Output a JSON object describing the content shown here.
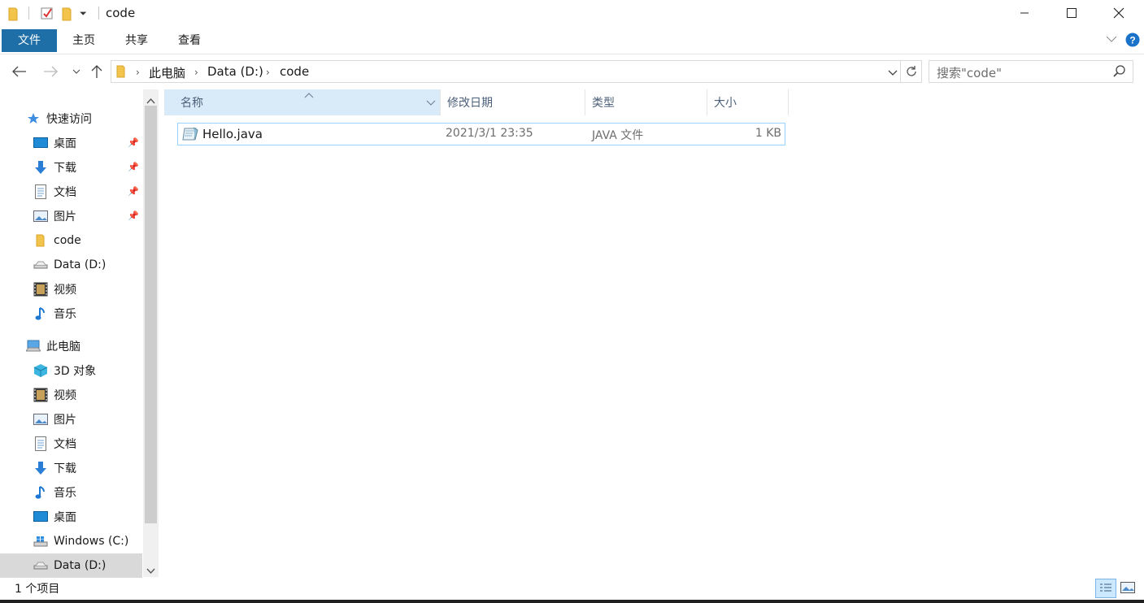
{
  "window": {
    "title": "code",
    "minimize_glyph": "—",
    "maximize_glyph": "☐",
    "close_glyph": "✕"
  },
  "ribbon": {
    "tabs": [
      "文件",
      "主页",
      "共享",
      "查看"
    ]
  },
  "address": {
    "crumbs": [
      "此电脑",
      "Data (D:)",
      "code"
    ],
    "search_placeholder": "搜索\"code\""
  },
  "nav": {
    "quick_access": "快速访问",
    "quick_items": [
      {
        "label": "桌面",
        "icon": "desktop-icon",
        "pinned": true
      },
      {
        "label": "下载",
        "icon": "download-icon",
        "pinned": true
      },
      {
        "label": "文档",
        "icon": "document-icon",
        "pinned": true
      },
      {
        "label": "图片",
        "icon": "pictures-icon",
        "pinned": true
      },
      {
        "label": "code",
        "icon": "folder-icon",
        "pinned": false
      },
      {
        "label": "Data (D:)",
        "icon": "drive-icon",
        "pinned": false
      },
      {
        "label": "视频",
        "icon": "video-icon",
        "pinned": false
      },
      {
        "label": "音乐",
        "icon": "music-icon",
        "pinned": false
      }
    ],
    "this_pc": "此电脑",
    "pc_items": [
      {
        "label": "3D 对象",
        "icon": "3d-objects-icon"
      },
      {
        "label": "视频",
        "icon": "video-icon"
      },
      {
        "label": "图片",
        "icon": "pictures-icon"
      },
      {
        "label": "文档",
        "icon": "document-icon"
      },
      {
        "label": "下载",
        "icon": "download-icon"
      },
      {
        "label": "音乐",
        "icon": "music-icon"
      },
      {
        "label": "桌面",
        "icon": "desktop-icon"
      },
      {
        "label": "Windows (C:)",
        "icon": "windows-drive-icon"
      },
      {
        "label": "Data (D:)",
        "icon": "drive-icon"
      }
    ]
  },
  "columns": {
    "name": "名称",
    "modified": "修改日期",
    "type": "类型",
    "size": "大小"
  },
  "files": [
    {
      "name": "Hello.java",
      "modified": "2021/3/1 23:35",
      "type": "JAVA 文件",
      "size": "1 KB"
    }
  ],
  "status": {
    "count": "1 个项目"
  },
  "colors": {
    "accent": "#1e6ea7",
    "selection": "#cce8ff",
    "folder": "#f3c44c",
    "header_text": "#4c607a"
  }
}
